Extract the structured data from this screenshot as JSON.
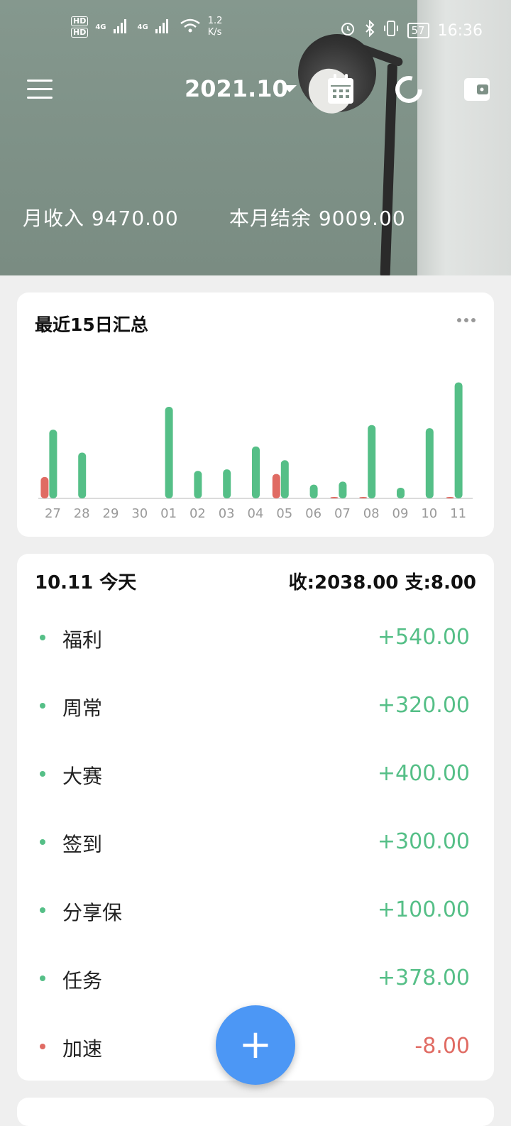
{
  "status_bar": {
    "hd1": "HD",
    "hd2": "HD",
    "net1": "4G",
    "net2": "4G",
    "speed": "1.2",
    "speed_unit": "K/s",
    "battery": "57",
    "time": "16:36"
  },
  "header": {
    "month": "2021.10",
    "income_label": "月收入 9470.00",
    "balance_label": "本月结余 9009.00"
  },
  "chart_card": {
    "title": "最近15日汇总"
  },
  "chart_data": {
    "type": "bar",
    "categories": [
      "27",
      "28",
      "29",
      "30",
      "01",
      "02",
      "03",
      "04",
      "05",
      "06",
      "07",
      "08",
      "09",
      "10",
      "11"
    ],
    "series": [
      {
        "values": [
          14,
          0,
          0,
          0,
          0,
          0,
          0,
          0,
          16,
          0,
          0.5,
          0.5,
          0,
          0,
          0.5
        ],
        "color": "#e06b63"
      },
      {
        "values": [
          45,
          30,
          0,
          0,
          60,
          18,
          19,
          34,
          25,
          9,
          11,
          48,
          7,
          46,
          76
        ],
        "color": "#55bf87"
      }
    ],
    "ylim": [
      0,
      80
    ]
  },
  "day": {
    "title": "10.11 今天",
    "summary": "收:2038.00 支:8.00",
    "items": [
      {
        "name": "福利",
        "amount": "+540.00",
        "type": "income"
      },
      {
        "name": "周常",
        "amount": "+320.00",
        "type": "income"
      },
      {
        "name": "大赛",
        "amount": "+400.00",
        "type": "income"
      },
      {
        "name": "签到",
        "amount": "+300.00",
        "type": "income"
      },
      {
        "name": "分享保",
        "amount": "+100.00",
        "type": "income"
      },
      {
        "name": "任务",
        "amount": "+378.00",
        "type": "income"
      },
      {
        "name": "加速",
        "amount": "-8.00",
        "type": "expense"
      }
    ]
  },
  "colors": {
    "income": "#55bf87",
    "expense": "#e06b63",
    "fab": "#4c97f5"
  },
  "fab_label": "+"
}
